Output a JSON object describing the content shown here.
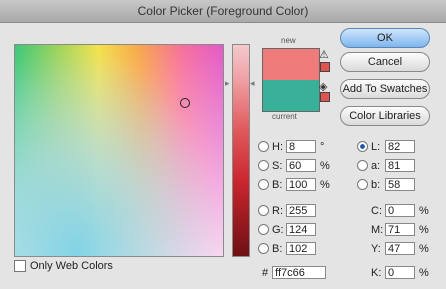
{
  "window": {
    "title": "Color Picker (Foreground Color)"
  },
  "labels": {
    "new": "new",
    "current": "current"
  },
  "buttons": {
    "ok": "OK",
    "cancel": "Cancel",
    "add_to_swatches": "Add To Swatches",
    "color_libraries": "Color Libraries"
  },
  "hsb": {
    "h": {
      "label": "H:",
      "value": "8",
      "unit": "°"
    },
    "s": {
      "label": "S:",
      "value": "60",
      "unit": "%"
    },
    "b": {
      "label": "B:",
      "value": "100",
      "unit": "%"
    }
  },
  "rgb": {
    "r": {
      "label": "R:",
      "value": "255"
    },
    "g": {
      "label": "G:",
      "value": "124"
    },
    "b": {
      "label": "B:",
      "value": "102"
    }
  },
  "lab": {
    "l": {
      "label": "L:",
      "value": "82"
    },
    "a": {
      "label": "a:",
      "value": "81"
    },
    "b": {
      "label": "b:",
      "value": "58"
    }
  },
  "cmyk": {
    "c": {
      "label": "C:",
      "value": "0",
      "unit": "%"
    },
    "m": {
      "label": "M:",
      "value": "71",
      "unit": "%"
    },
    "y": {
      "label": "Y:",
      "value": "47",
      "unit": "%"
    },
    "k": {
      "label": "K:",
      "value": "0",
      "unit": "%"
    }
  },
  "hex": {
    "label": "#",
    "value": "ff7c66"
  },
  "only_web_colors": "Only Web Colors",
  "colors": {
    "new": "#ef7c7a",
    "current": "#38b09a",
    "accent": "#7eb5ee"
  }
}
